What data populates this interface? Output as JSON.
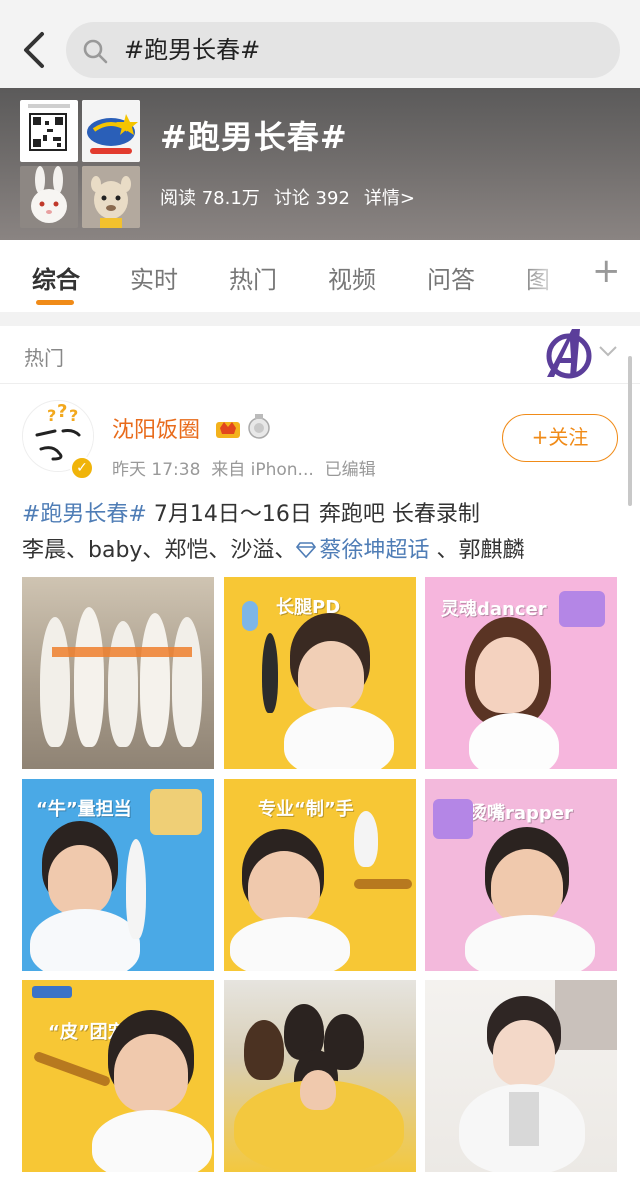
{
  "search": {
    "query": "#跑男长春#"
  },
  "topic": {
    "title": "#跑男长春#",
    "reads": "阅读 78.1万",
    "discussions": "讨论 392",
    "details": "详情>"
  },
  "tabs": [
    "综合",
    "实时",
    "热门",
    "视频",
    "问答",
    "图"
  ],
  "section": {
    "label": "热门"
  },
  "post": {
    "username": "沈阳饭圈",
    "time": "昨天 17:38",
    "source": "来自 iPhon...",
    "edited": "已编辑",
    "follow_label": "+关注",
    "text": {
      "hashtag": "#跑男长春#",
      "line1_rest": " 7月14日～16日 奔跑吧 长春录制",
      "line2_start": "李晨、baby、郑恺、沙溢、",
      "supertopic": "蔡徐坤超话",
      "line2_end": " 、郭麒麟"
    }
  },
  "images": {
    "captions": [
      "长腿PD",
      "灵魂dancer",
      "“牛”量担当",
      "专业“制”手",
      "烫嘴rapper",
      "“皮”团宠"
    ]
  },
  "colors": {
    "accent": "#f08b18",
    "username": "#e86b1b",
    "link": "#4f7db6"
  }
}
